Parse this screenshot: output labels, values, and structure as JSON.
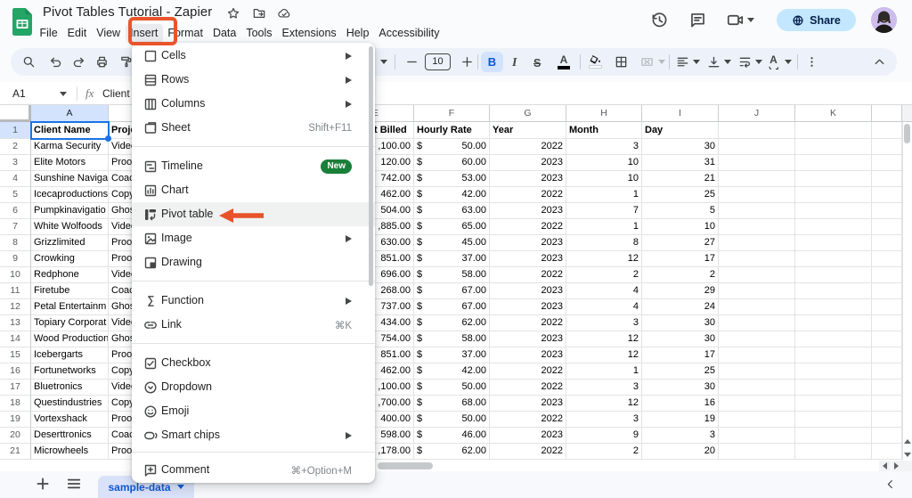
{
  "window": {
    "app": "Google Sheets",
    "title": "Pivot Tables Tutorial - Zapier"
  },
  "header": {
    "title": "Pivot Tables Tutorial - Zapier",
    "menu_bar": [
      "File",
      "Edit",
      "View",
      "Insert",
      "Format",
      "Data",
      "Tools",
      "Extensions",
      "Help",
      "Accessibility"
    ],
    "share_label": "Share"
  },
  "toolbar": {
    "font_size": "10"
  },
  "formula_bar": {
    "cell_ref": "A1",
    "value": "Client Name"
  },
  "insert_menu": {
    "items": [
      {
        "label": "Cells",
        "icon": "cells",
        "submenu": true
      },
      {
        "label": "Rows",
        "icon": "rows",
        "submenu": true
      },
      {
        "label": "Columns",
        "icon": "columns",
        "submenu": true
      },
      {
        "label": "Sheet",
        "icon": "sheet",
        "shortcut": "Shift+F11"
      },
      {
        "label": "Timeline",
        "icon": "timeline",
        "badge": "New"
      },
      {
        "label": "Chart",
        "icon": "chart"
      },
      {
        "label": "Pivot table",
        "icon": "pivot-table",
        "highlighted": true,
        "arrow": true
      },
      {
        "label": "Image",
        "icon": "image",
        "submenu": true
      },
      {
        "label": "Drawing",
        "icon": "drawing"
      },
      {
        "label": "Function",
        "icon": "function",
        "submenu": true
      },
      {
        "label": "Link",
        "icon": "link",
        "shortcut": "⌘K"
      },
      {
        "label": "Checkbox",
        "icon": "checkbox"
      },
      {
        "label": "Dropdown",
        "icon": "dropdown"
      },
      {
        "label": "Emoji",
        "icon": "emoji"
      },
      {
        "label": "Smart chips",
        "icon": "smart-chips",
        "submenu": true
      },
      {
        "label": "Comment",
        "icon": "comment",
        "shortcut": "⌘+Option+M"
      }
    ]
  },
  "annotations": {
    "box_color": "#e8552b",
    "arrow_color": "#e8522a"
  },
  "grid": {
    "col_letters": [
      "A",
      "B",
      "C",
      "D",
      "E",
      "F",
      "G",
      "H",
      "I",
      "J",
      "K"
    ],
    "row_numbers": [
      "1",
      "2",
      "3",
      "4",
      "5",
      "6",
      "7",
      "8",
      "9",
      "10",
      "11",
      "12",
      "13",
      "14",
      "15",
      "16",
      "17",
      "18",
      "19",
      "20",
      "21"
    ],
    "headers": {
      "a": "Client Name",
      "b": "Proje",
      "e": "t Billed",
      "f": "Hourly Rate",
      "g": "Year",
      "h": "Month",
      "i": "Day"
    },
    "currency": "$",
    "rows": [
      {
        "a": "Karma Security",
        "b": "Video",
        "e": ",100.00",
        "f": "50.00",
        "g": "2022",
        "h": "3",
        "i": "30"
      },
      {
        "a": "Elite Motors",
        "b": "Proof",
        "e": "120.00",
        "f": "60.00",
        "g": "2023",
        "h": "10",
        "i": "31"
      },
      {
        "a": "Sunshine Naviga",
        "b": "Coach",
        "e": "742.00",
        "f": "53.00",
        "g": "2023",
        "h": "10",
        "i": "21"
      },
      {
        "a": "Icecaproductions",
        "b": "Copy",
        "e": "462.00",
        "f": "42.00",
        "g": "2022",
        "h": "1",
        "i": "25"
      },
      {
        "a": "Pumpkinavigatio",
        "b": "Ghost",
        "e": "504.00",
        "f": "63.00",
        "g": "2023",
        "h": "7",
        "i": "5"
      },
      {
        "a": "White Wolfoods",
        "b": "Video",
        "e": ",885.00",
        "f": "65.00",
        "g": "2022",
        "h": "1",
        "i": "10"
      },
      {
        "a": "Grizzlimited",
        "b": "Proof",
        "e": "630.00",
        "f": "45.00",
        "g": "2023",
        "h": "8",
        "i": "27"
      },
      {
        "a": "Crowking",
        "b": "Proof",
        "e": "851.00",
        "f": "37.00",
        "g": "2023",
        "h": "12",
        "i": "17"
      },
      {
        "a": "Redphone",
        "b": "Video",
        "e": "696.00",
        "f": "58.00",
        "g": "2022",
        "h": "2",
        "i": "2"
      },
      {
        "a": "Firetube",
        "b": "Coach",
        "e": "268.00",
        "f": "67.00",
        "g": "2023",
        "h": "4",
        "i": "29"
      },
      {
        "a": "Petal Entertainm",
        "b": "Ghost",
        "e": "737.00",
        "f": "67.00",
        "g": "2023",
        "h": "4",
        "i": "24"
      },
      {
        "a": "Topiary Corporat",
        "b": "Video",
        "e": "434.00",
        "f": "62.00",
        "g": "2022",
        "h": "3",
        "i": "30"
      },
      {
        "a": "Wood Production",
        "b": "Ghost",
        "e": "754.00",
        "f": "58.00",
        "g": "2023",
        "h": "12",
        "i": "30"
      },
      {
        "a": "Icebergarts",
        "b": "Proof",
        "e": "851.00",
        "f": "37.00",
        "g": "2023",
        "h": "12",
        "i": "17"
      },
      {
        "a": "Fortunetworks",
        "b": "Copy",
        "e": "462.00",
        "f": "42.00",
        "g": "2022",
        "h": "1",
        "i": "25"
      },
      {
        "a": "Bluetronics",
        "b": "Video",
        "e": ",100.00",
        "f": "50.00",
        "g": "2022",
        "h": "3",
        "i": "30"
      },
      {
        "a": "Questindustries",
        "b": "Copy",
        "e": ",700.00",
        "f": "68.00",
        "g": "2023",
        "h": "12",
        "i": "16"
      },
      {
        "a": "Vortexshack",
        "b": "Proof",
        "e": "400.00",
        "f": "50.00",
        "g": "2022",
        "h": "3",
        "i": "19"
      },
      {
        "a": "Deserttronics",
        "b": "Coach",
        "e": "598.00",
        "f": "46.00",
        "g": "2023",
        "h": "9",
        "i": "3"
      },
      {
        "a": "Microwheels",
        "b": "Proof",
        "e": ",178.00",
        "f": "62.00",
        "g": "2022",
        "h": "2",
        "i": "20"
      }
    ]
  },
  "sheet_bar": {
    "active_tab": "sample-data"
  },
  "colors": {
    "annotation_orange": "#e8552b",
    "toolbar_pill": "#edf2fa",
    "selection_blue": "#1a73e8",
    "selected_header": "#d3e3fd",
    "share_pill": "#c2e7ff",
    "badge_green": "#188038",
    "active_tab_bg": "#d9e2f9",
    "active_tab_text": "#0b57d0"
  }
}
